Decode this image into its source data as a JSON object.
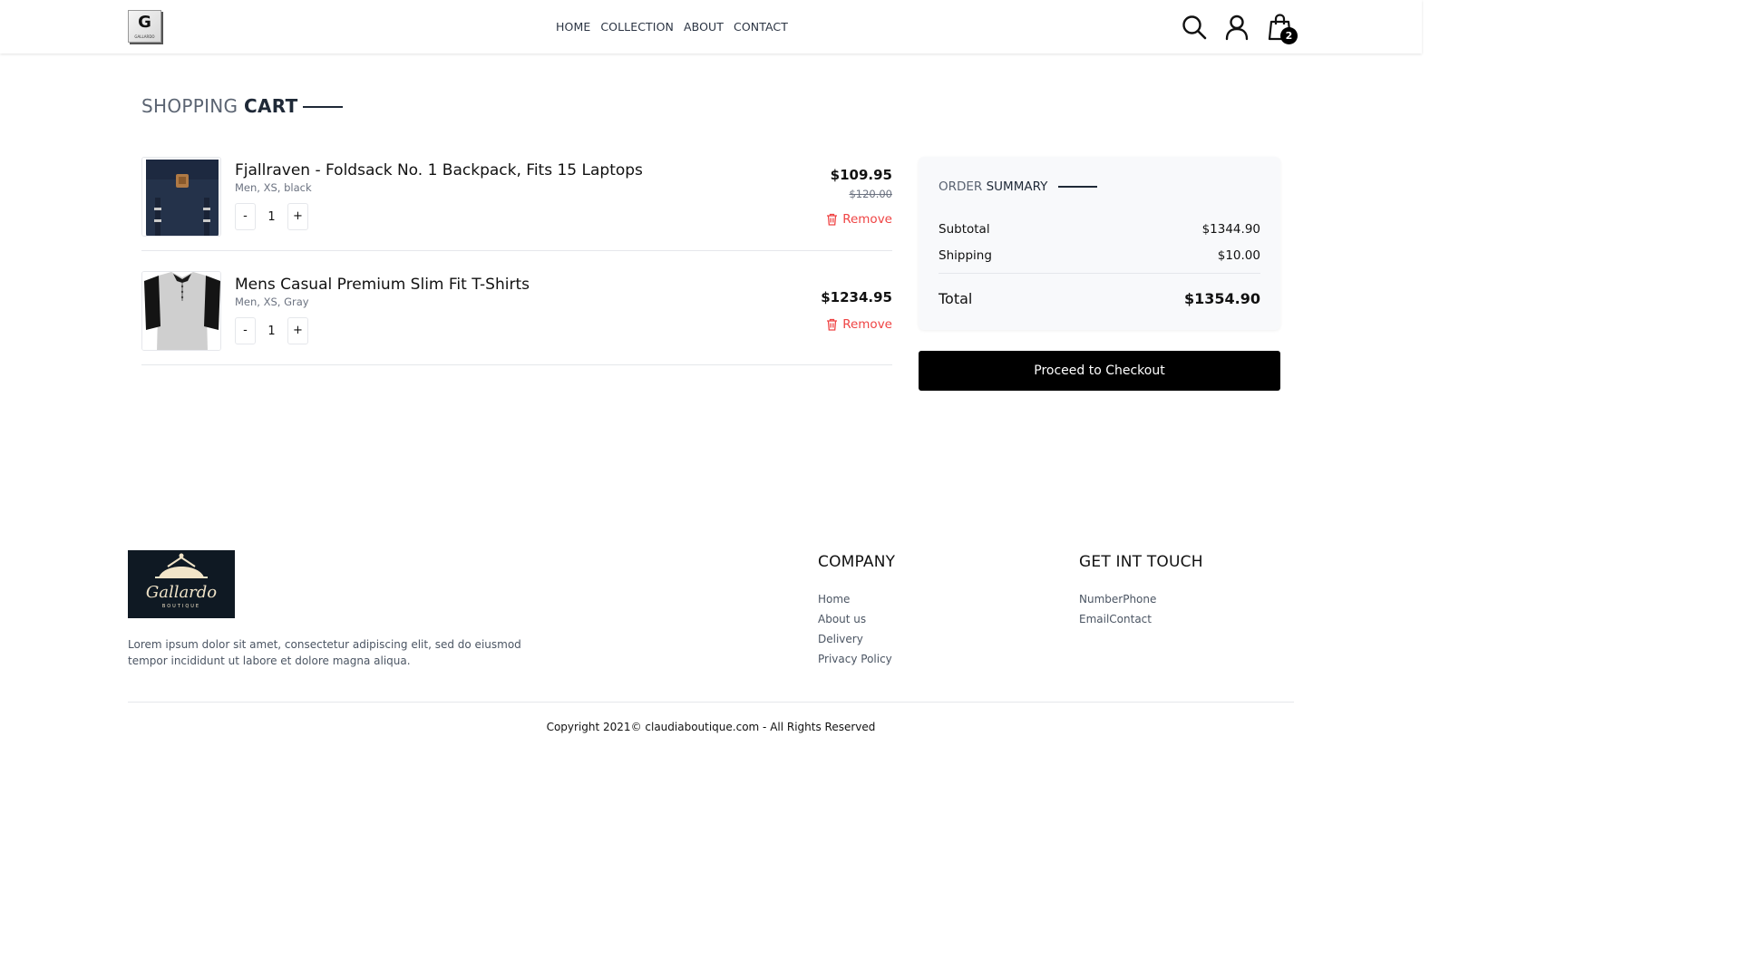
{
  "header": {
    "logo_letter": "G",
    "logo_subtext": "GALLARDO",
    "nav": [
      "HOME",
      "COLLECTION",
      "ABOUT",
      "CONTACT"
    ],
    "cart_count": "2"
  },
  "page": {
    "title_light": "SHOPPING",
    "title_bold": "CART"
  },
  "cart": {
    "items": [
      {
        "name": "Fjallraven - Foldsack No. 1 Backpack, Fits 15 Laptops",
        "meta": "Men, XS, black",
        "quantity": "1",
        "price": "$109.95",
        "old_price": "$120.00",
        "remove_label": "Remove"
      },
      {
        "name": "Mens Casual Premium Slim Fit T-Shirts",
        "meta": "Men, XS, Gray",
        "quantity": "1",
        "price": "$1234.95",
        "remove_label": "Remove"
      }
    ],
    "minus_label": "-",
    "plus_label": "+"
  },
  "summary": {
    "title_light": "ORDER",
    "title_bold": "SUMMARY",
    "subtotal_label": "Subtotal",
    "subtotal_value": "$1344.90",
    "shipping_label": "Shipping",
    "shipping_value": "$10.00",
    "total_label": "Total",
    "total_value": "$1354.90",
    "checkout_label": "Proceed to Checkout"
  },
  "footer": {
    "logo_text": "Gallardo",
    "logo_subtext": "BOUTIQUE",
    "description": "Lorem ipsum dolor sit amet, consectetur adipiscing elit, sed do eiusmod tempor incididunt ut labore et dolore magna aliqua.",
    "company_heading": "COMPANY",
    "company_links": [
      "Home",
      "About us",
      "Delivery",
      "Privacy Policy"
    ],
    "contact_heading": "GET INT TOUCH",
    "contact_links": [
      "NumberPhone",
      "EmailContact"
    ],
    "copyright": "Copyright 2021© claudiaboutique.com - All Rights Reserved"
  },
  "colors": {
    "accent": "#000000",
    "danger": "#ef4444",
    "muted": "#6b7280",
    "summary_bg": "#f8f9fb"
  }
}
